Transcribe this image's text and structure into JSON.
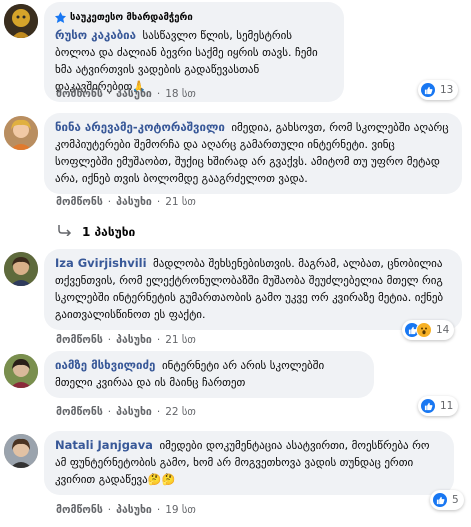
{
  "labels": {
    "like": "მომწონს",
    "reply": "პასუხი",
    "dot": "·"
  },
  "comments": [
    {
      "badge": "საუკეთესო მხარდამჭერი",
      "author": "რუსო კაკაბია",
      "text": "სასწავლო წლის, სემესტრის ბოლოა და ძალიან ბევრი საქმე იყრის თავს. ჩემი ხმა ატვირთვის ვადების გადაწევასთან დაკავშირებით🙏",
      "time": "18 სთ",
      "reactions": "13"
    },
    {
      "author": "ნინა არევამე-კოტორაშვილი",
      "text": "იმედია, გახსოვთ, რომ სკოლებში აღარც კომპიუტერები შემორჩა და აღარც გამართული ინტერნეტი. ვინც სოფლებში ემუშაობთ, შუქიც ხშირად არ გვაქვს. ამიტომ თუ უფრო მეტად არა, იქნებ თვის ბოლომდე გააგრძელოთ ვადა.",
      "time": "21 სთ",
      "reactions": "",
      "replies": "1 პასუხი"
    },
    {
      "author": "Iza Gvirjishvili",
      "text": "მადლობა შეხსენებისთვის. მაგრამ, ალბათ, ცნობილია თქვენთვის, რომ ელექტრონულობაზში მუშაობა შეუძლებელია მთელ რიგ სკოლებში ინტერნეტის გუმართაობის გამო უკვე ორ კვირაზე მეტია. იქნებ გაითვალისწინოთ ეს ფაქტი.",
      "time": "21 სთ",
      "reactions": "14"
    },
    {
      "author": "იამზე მსხვილიძე",
      "text": "ინტერნეტი არ არის სკოლებში მთელი კვირაა და ის მაინც ჩართეთ",
      "time": "22 სთ",
      "reactions": "11"
    },
    {
      "author": "Natali Janjgava",
      "text": "იმედები დოკუმენტაცია ასატვირთი, მოესწრება რო ამ ფუნტერნეტობის გამო, ხომ არ მოგვეთხოვა ვადის თუნდაც ერთი კვირით გადაწევა🤔🤔",
      "time": "19 სთ",
      "reactions": "5"
    }
  ],
  "colors": {
    "link": "#385898",
    "bubble": "#f0f2f5",
    "meta": "#65676b",
    "like": "#1877f2"
  }
}
